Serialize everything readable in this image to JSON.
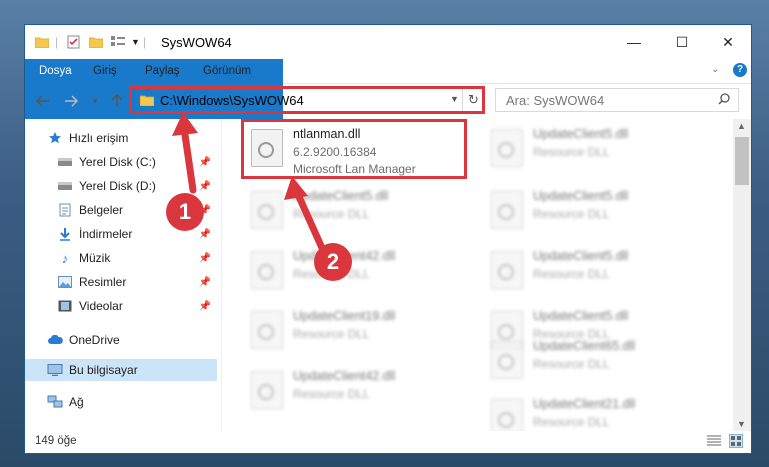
{
  "window": {
    "title": "SysWOW64",
    "controls": {
      "minimize": "—",
      "maximize": "☐",
      "close": "✕"
    }
  },
  "ribbon": {
    "tabs": [
      "Dosya",
      "Giriş",
      "Paylaş",
      "Görünüm"
    ]
  },
  "address": {
    "path": "C:\\Windows\\SysWOW64",
    "search_placeholder": "Ara: SysWOW64"
  },
  "navpane": {
    "quick_access": "Hızlı erişim",
    "items": [
      {
        "label": "Yerel Disk (C:)",
        "icon": "drive-icon",
        "pinned": true
      },
      {
        "label": "Yerel Disk (D:)",
        "icon": "drive-icon",
        "pinned": true
      },
      {
        "label": "Belgeler",
        "icon": "documents-icon",
        "pinned": true
      },
      {
        "label": "İndirmeler",
        "icon": "download-icon",
        "pinned": true
      },
      {
        "label": "Müzik",
        "icon": "music-icon",
        "pinned": true
      },
      {
        "label": "Resimler",
        "icon": "pictures-icon",
        "pinned": true
      },
      {
        "label": "Videolar",
        "icon": "videos-icon",
        "pinned": true
      }
    ],
    "onedrive": "OneDrive",
    "this_pc": "Bu bilgisayar",
    "network": "Ağ"
  },
  "files": {
    "main": {
      "name": "ntlanman.dll",
      "version": "6.2.9200.16384",
      "description": "Microsoft Lan Manager"
    },
    "left_blurred": [
      {
        "name": "UpdateClient5.dll",
        "type": "Resource DLL"
      },
      {
        "name": "UpdateClient42.dll",
        "type": "Resource DLL"
      },
      {
        "name": "UpdateClient19.dll",
        "type": "Resource DLL"
      },
      {
        "name": "UpdateClient42.dll",
        "type": "Resource DLL"
      }
    ],
    "right_blurred": [
      {
        "name": "UpdateClient5.dll",
        "type": "Resource DLL"
      },
      {
        "name": "UpdateClient5.dll",
        "type": "Resource DLL"
      },
      {
        "name": "UpdateClient5.dll",
        "type": "Resource DLL"
      },
      {
        "name": "UpdateClient5.dll",
        "type": "Resource DLL"
      },
      {
        "name": "UpdateClient65.dll",
        "type": "Resource DLL"
      },
      {
        "name": "UpdateClient21.dll",
        "type": "Resource DLL"
      }
    ]
  },
  "status": {
    "count": "149 öğe"
  },
  "callouts": {
    "one": "1",
    "two": "2"
  },
  "colors": {
    "accent": "#1979ca",
    "highlight": "#d9363e",
    "selected": "#cce4f7"
  }
}
